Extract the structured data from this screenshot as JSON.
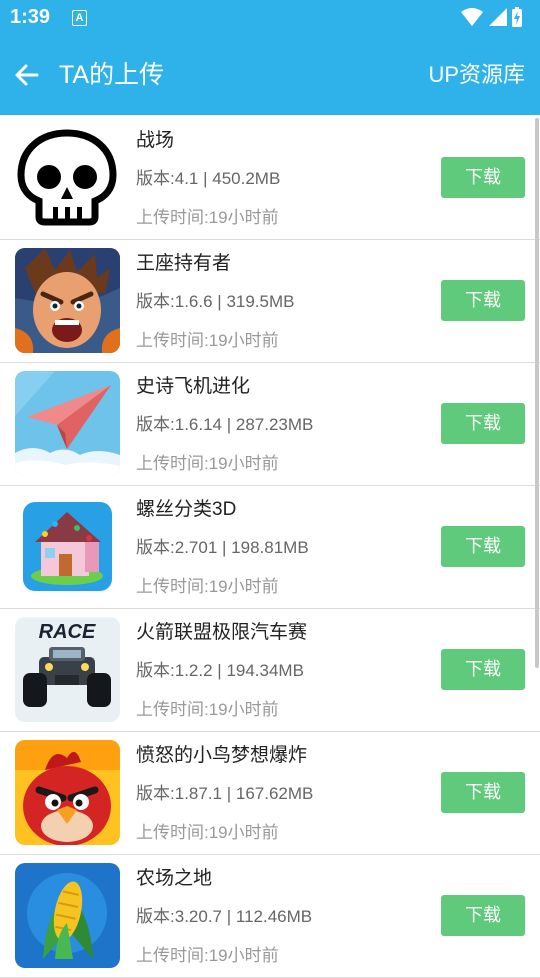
{
  "status_bar": {
    "time": "1:39",
    "notification_letter": "A"
  },
  "app_bar": {
    "title": "TA的上传",
    "action": "UP资源库"
  },
  "items": [
    {
      "name": "战场",
      "version_prefix": "版本:",
      "version": "4.1",
      "sep": "|",
      "size": "450.2MB",
      "upload_time": "上传时间:19小时前",
      "button": "下载",
      "icon": "skull-icon"
    },
    {
      "name": "王座持有者",
      "version_prefix": "版本:",
      "version": "1.6.6",
      "sep": "|",
      "size": "319.5MB",
      "upload_time": "上传时间:19小时前",
      "button": "下载",
      "icon": "angry-hero-icon"
    },
    {
      "name": "史诗飞机进化",
      "version_prefix": "版本:",
      "version": "1.6.14",
      "sep": "|",
      "size": "287.23MB",
      "upload_time": "上传时间:19小时前",
      "button": "下载",
      "icon": "paper-plane-icon"
    },
    {
      "name": "螺丝分类3D",
      "version_prefix": "版本:",
      "version": "2.701",
      "sep": "|",
      "size": "198.81MB",
      "upload_time": "上传时间:19小时前",
      "button": "下载",
      "icon": "toy-house-icon"
    },
    {
      "name": "火箭联盟极限汽车赛",
      "version_prefix": "版本:",
      "version": "1.2.2",
      "sep": "|",
      "size": "194.34MB",
      "upload_time": "上传时间:19小时前",
      "button": "下载",
      "icon": "race-truck-icon",
      "icon_text": "RACE"
    },
    {
      "name": "愤怒的小鸟梦想爆炸",
      "version_prefix": "版本:",
      "version": "1.87.1",
      "sep": "|",
      "size": "167.62MB",
      "upload_time": "上传时间:19小时前",
      "button": "下载",
      "icon": "red-bird-icon"
    },
    {
      "name": "农场之地",
      "version_prefix": "版本:",
      "version": "3.20.7",
      "sep": "|",
      "size": "112.46MB",
      "upload_time": "上传时间:19小时前",
      "button": "下载",
      "icon": "corn-icon"
    }
  ],
  "colors": {
    "header": "#2fb2ea",
    "download_button": "#5fca7b"
  }
}
